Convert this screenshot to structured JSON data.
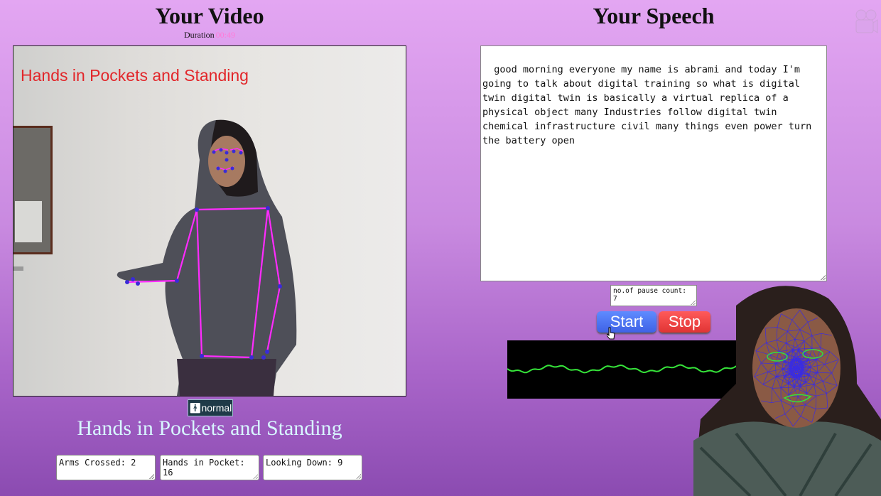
{
  "video_panel": {
    "title": "Your Video",
    "duration_label": "Duration",
    "duration_value": "00:49",
    "overlay_label": "Hands in Pockets and Standing",
    "posture_badge": "normal",
    "posture_label": "Hands in Pockets and Standing",
    "counters": [
      {
        "label": "Arms Crossed: 2"
      },
      {
        "label": "Hands in Pocket: 16"
      },
      {
        "label": "Looking Down: 9"
      }
    ]
  },
  "speech_panel": {
    "title": "Your Speech",
    "transcript": "good morning everyone my name is abrami and today I'm going to talk about digital training so what is digital twin digital twin is basically a virtual replica of a physical object many Industries follow digital twin chemical infrastructure civil many things even power turn the battery open",
    "pause_count": "no.of pause count: 7",
    "start_label": "Start",
    "stop_label": "Stop"
  },
  "icons": {
    "camera": "camera-icon",
    "posture": "person-standing-icon",
    "cursor": "pointer-cursor-icon"
  },
  "colors": {
    "landmark_line": "#ff2bff",
    "landmark_point": "#3a2bd8",
    "waveform": "#36e43a",
    "start": "#4f74f5",
    "stop": "#ef4444"
  }
}
